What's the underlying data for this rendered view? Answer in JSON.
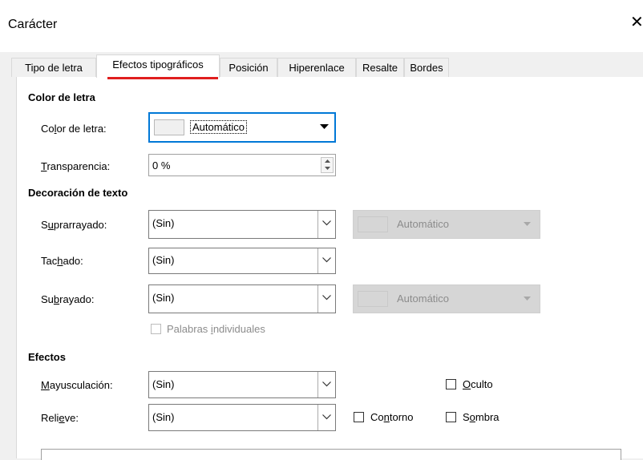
{
  "window": {
    "title": "Carácter",
    "close_glyph": "✕"
  },
  "tabs": [
    {
      "label": "Tipo de letra",
      "active": false
    },
    {
      "label": "Efectos tipográficos",
      "active": true
    },
    {
      "label": "Posición",
      "active": false
    },
    {
      "label": "Hiperenlace",
      "active": false
    },
    {
      "label": "Resalte",
      "active": false
    },
    {
      "label": "Bordes",
      "active": false
    }
  ],
  "font_color": {
    "heading": "Color de letra",
    "color_label": "Color de letra:",
    "color_value": "Automático",
    "transparency_label": "Transparencia:",
    "transparency_value": "0 %"
  },
  "decoration": {
    "heading": "Decoración de texto",
    "overline_label": "Suprarrayado:",
    "overline_value": "(Sin)",
    "overline_color": "Automático",
    "strikethrough_label": "Tachado:",
    "strikethrough_value": "(Sin)",
    "underline_label": "Subrayado:",
    "underline_value": "(Sin)",
    "underline_color": "Automático",
    "individual_words_label": "Palabras individuales"
  },
  "effects": {
    "heading": "Efectos",
    "case_label": "Mayusculación:",
    "case_value": "(Sin)",
    "relief_label": "Relieve:",
    "relief_value": "(Sin)",
    "hidden_label": "Oculto",
    "outline_label": "Contorno",
    "shadow_label": "Sombra"
  },
  "colors": {
    "active_border": "#0078d7",
    "tab_underline": "#e01e1e"
  }
}
